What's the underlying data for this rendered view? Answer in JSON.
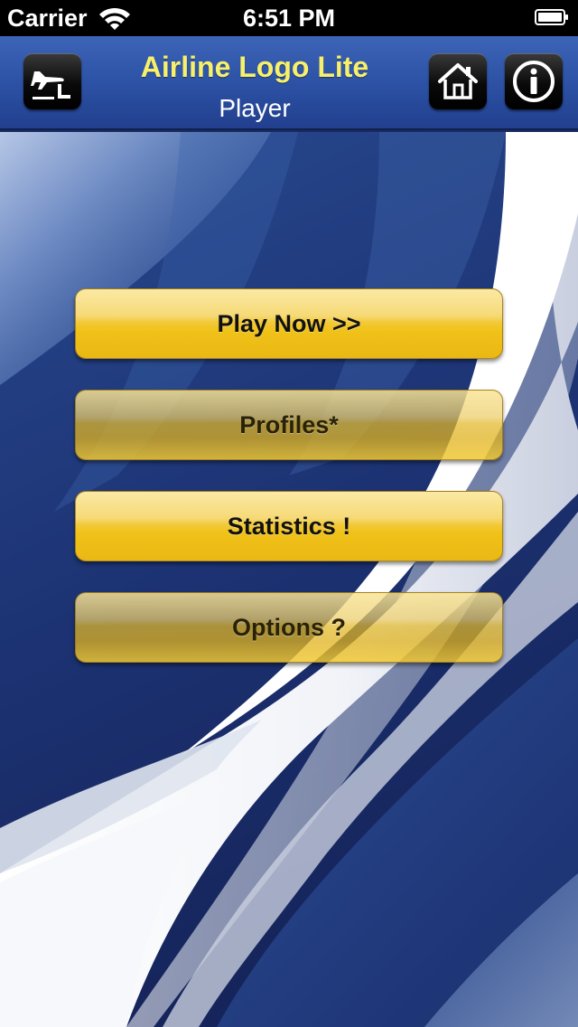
{
  "status_bar": {
    "carrier": "Carrier",
    "time": "6:51 PM"
  },
  "nav": {
    "title": "Airline Logo Lite",
    "subtitle": "Player",
    "left_icon": "airplane-landing-icon",
    "home_icon": "home-icon",
    "info_icon": "info-icon"
  },
  "menu": {
    "play_label": "Play Now >>",
    "profiles_label": "Profiles*",
    "statistics_label": "Statistics !",
    "options_label": "Options ?"
  },
  "colors": {
    "title_yellow": "#f7f06a",
    "nav_blue": "#2e54a8",
    "button_gold": "#f0c219",
    "background_navy": "#1a2a5e"
  }
}
